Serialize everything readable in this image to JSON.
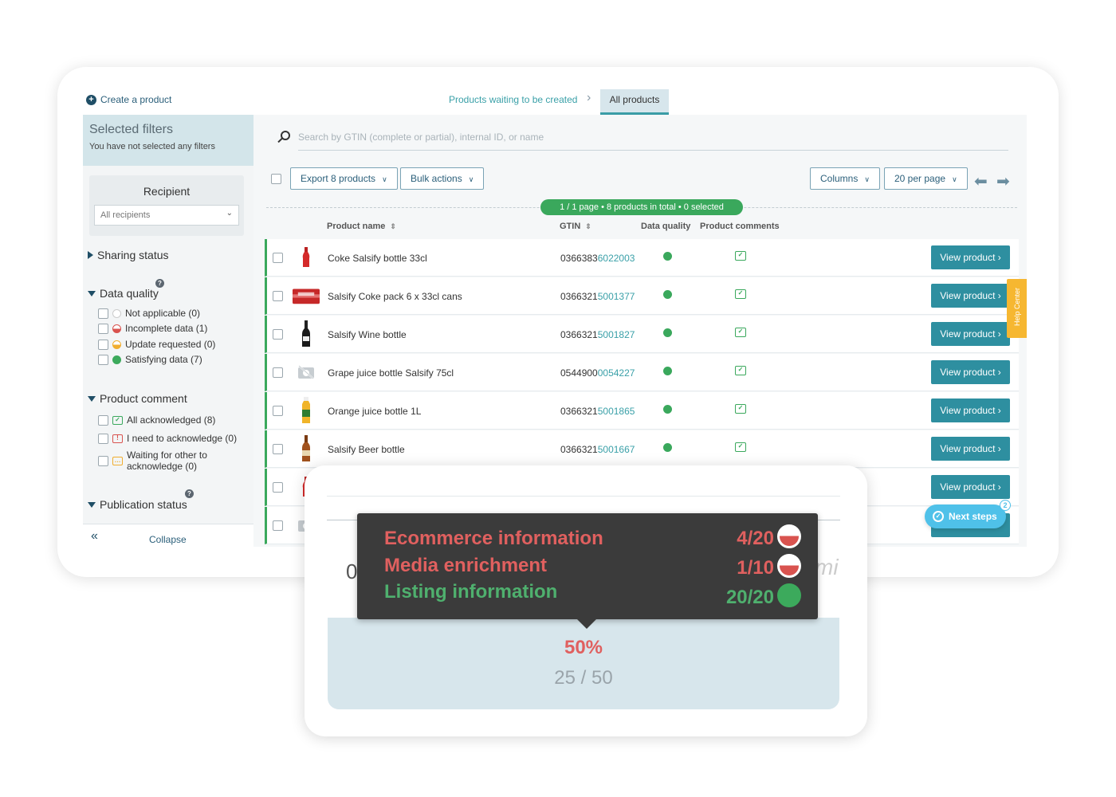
{
  "header": {
    "create_label": "Create a product",
    "crumb_waiting": "Products waiting to be created",
    "crumb_all": "All products"
  },
  "sidebar": {
    "selected_title": "Selected filters",
    "selected_sub": "You have not selected any filters",
    "recipient_title": "Recipient",
    "recipient_value": "All recipients",
    "sharing_status": "Sharing status",
    "data_quality": "Data quality",
    "dq_options": [
      "Not applicable (0)",
      "Incomplete data (1)",
      "Update requested (0)",
      "Satisfying data (7)"
    ],
    "product_comment": "Product comment",
    "pc_options": [
      "All acknowledged (8)",
      "I need to acknowledge (0)",
      "Waiting for other to",
      "acknowledge (0)"
    ],
    "publication_status": "Publication status",
    "collapse": "Collapse"
  },
  "toolbar": {
    "search_placeholder": "Search by GTIN (complete or partial), internal ID, or name",
    "export": "Export 8 products",
    "bulk": "Bulk actions",
    "columns": "Columns",
    "per_page": "20 per page",
    "summary": "1 / 1 page  •  8 products in total  •  0 selected"
  },
  "table": {
    "headers": [
      "Product name",
      "GTIN",
      "Data quality",
      "Product comments"
    ],
    "view_label": "View product",
    "rows": [
      {
        "name": "Coke Salsify bottle 33cl",
        "gtin_a": "0366383",
        "gtin_b": "6022003"
      },
      {
        "name": "Salsify Coke pack 6 x 33cl cans",
        "gtin_a": "0366321",
        "gtin_b": "5001377"
      },
      {
        "name": "Salsify Wine bottle",
        "gtin_a": "0366321",
        "gtin_b": "5001827"
      },
      {
        "name": "Grape juice bottle Salsify 75cl",
        "gtin_a": "0544900",
        "gtin_b": "0054227"
      },
      {
        "name": "Orange juice bottle 1L",
        "gtin_a": "0366321",
        "gtin_b": "5001865"
      },
      {
        "name": "Salsify Beer bottle",
        "gtin_a": "0366321",
        "gtin_b": "5001667"
      }
    ]
  },
  "help_center": "Help Center",
  "next_steps": {
    "label": "Next steps",
    "badge": "2"
  },
  "popup": {
    "ghost_left": "0",
    "ghost_right": "mi",
    "tooltip": [
      {
        "label": "Ecommerce information",
        "value": "4/20"
      },
      {
        "label": "Media enrichment",
        "value": "1/10"
      },
      {
        "label": "Listing information",
        "value": "20/20"
      }
    ],
    "percent": "50%",
    "ratio": "25 / 50"
  },
  "colors": {
    "accent": "#2e8fa0",
    "ok": "#3aa85c",
    "bad": "#e0605f",
    "help": "#f6b731"
  }
}
